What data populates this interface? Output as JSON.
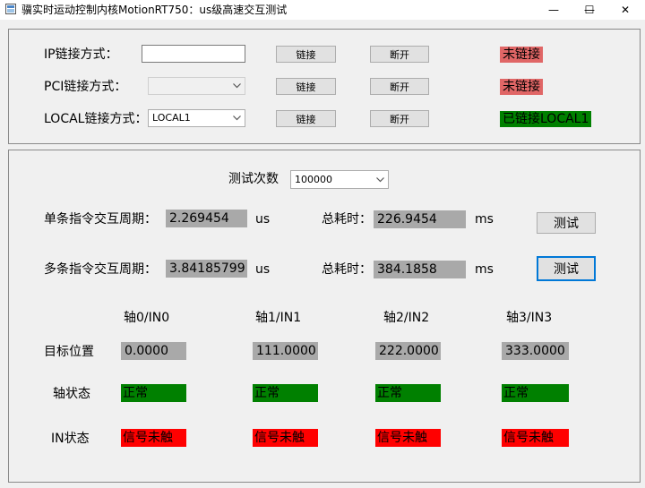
{
  "window": {
    "title": "骥实时运动控制内核MotionRT750：us级高速交互测试",
    "min_glyph": "—",
    "max_glyph": "☐",
    "close_glyph": "✕"
  },
  "connect": {
    "ip": {
      "label": "IP链接方式：",
      "value": "",
      "link_label": "链接",
      "disconnect_label": "断开",
      "status": "未链接"
    },
    "pci": {
      "label": "PCI链接方式：",
      "value": "",
      "link_label": "链接",
      "disconnect_label": "断开",
      "status": "未链接"
    },
    "local": {
      "label": "LOCAL链接方式：",
      "value": "LOCAL1",
      "link_label": "链接",
      "disconnect_label": "断开",
      "status": "已链接LOCAL1"
    }
  },
  "test": {
    "count_label": "测试次数",
    "count_value": "100000",
    "single": {
      "label": "单条指令交互周期：",
      "value": "2.269454",
      "unit": "us",
      "total_label": "总耗时：",
      "total_value": "226.9454",
      "total_unit": "ms",
      "button": "测试"
    },
    "multi": {
      "label": "多条指令交互周期：",
      "value": "3.84185799",
      "unit": "us",
      "total_label": "总耗时：",
      "total_value": "384.1858",
      "total_unit": "ms",
      "button": "测试"
    }
  },
  "axes": {
    "row_labels": {
      "target": "目标位置",
      "state": "轴状态",
      "input": "IN状态"
    },
    "items": [
      {
        "header": "轴0/IN0",
        "target": "0.0000",
        "state": "正常",
        "input": "信号未触"
      },
      {
        "header": "轴1/IN1",
        "target": "111.0000",
        "state": "正常",
        "input": "信号未触"
      },
      {
        "header": "轴2/IN2",
        "target": "222.0000",
        "state": "正常",
        "input": "信号未触"
      },
      {
        "header": "轴3/IN3",
        "target": "333.0000",
        "state": "正常",
        "input": "信号未触"
      }
    ]
  },
  "colors": {
    "status_disconnected": "#e06666",
    "status_connected": "#008000",
    "axis_ok": "#008000",
    "input_off": "#ff0000",
    "value_box": "#a9a9a9",
    "focus_border": "#0078d7"
  }
}
